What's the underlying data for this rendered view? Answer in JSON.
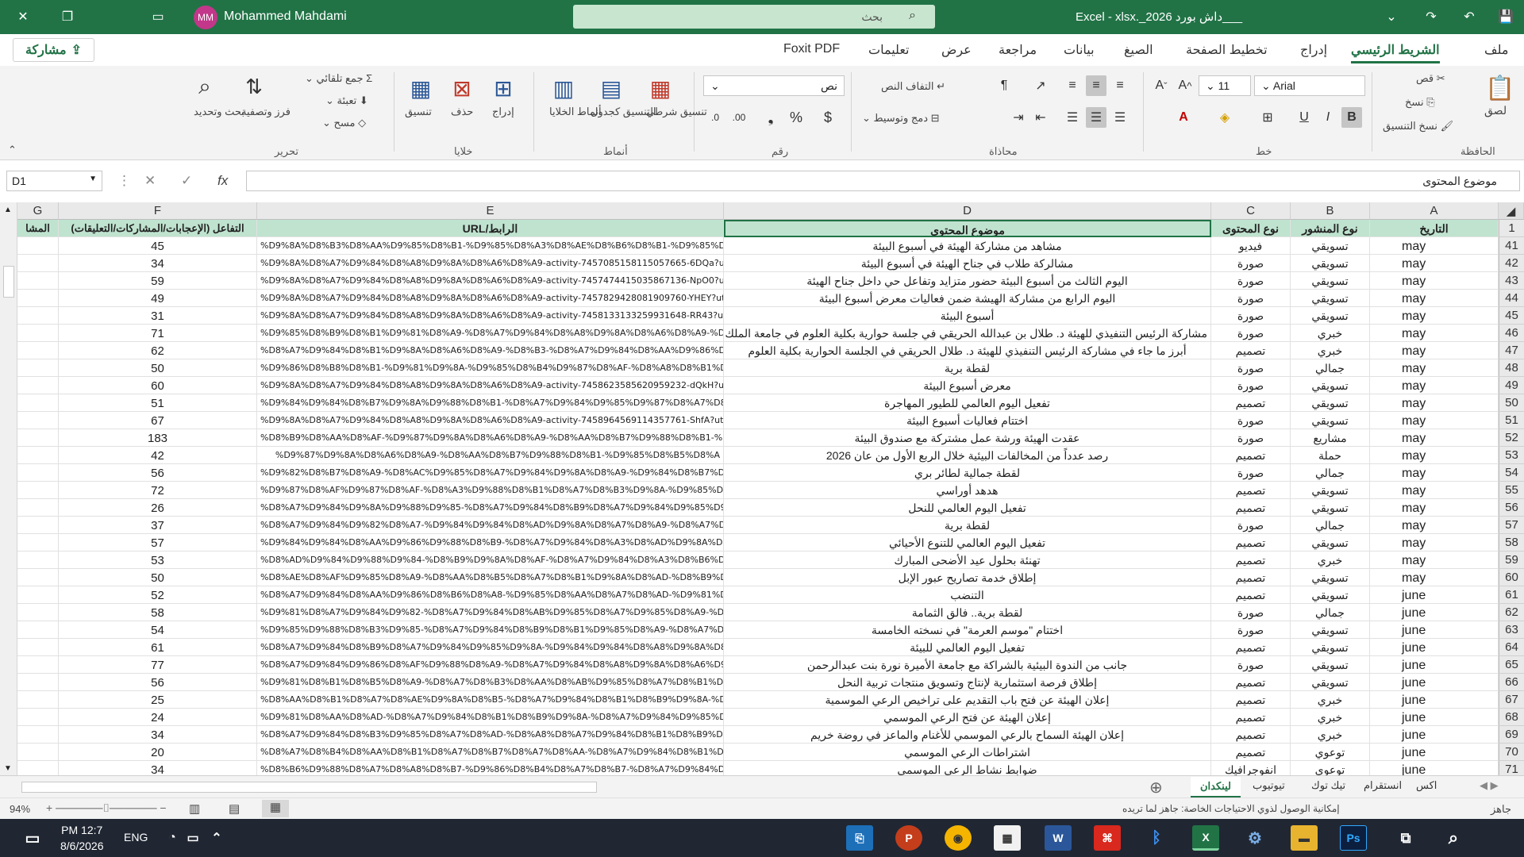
{
  "titlebar": {
    "user_initials": "MM",
    "user_name": "Mohammed Mahdami",
    "search_placeholder": "بحث",
    "doc_title": "Excel  -  xlsx._2026 داش بورد___"
  },
  "share_label": "مشاركة",
  "tabs": [
    "ملف",
    "الشريط الرئيسي",
    "إدراج",
    "تخطيط الصفحة",
    "الصيغ",
    "بيانات",
    "مراجعة",
    "عرض",
    "تعليمات",
    "Foxit PDF"
  ],
  "ribbon": {
    "clipboard": {
      "paste": "لصق",
      "cut": "قص",
      "copy": "نسخ",
      "format_painter": "نسخ التنسيق",
      "group": "الحافظة"
    },
    "font": {
      "name": "Arial",
      "size": "11",
      "group": "خط"
    },
    "alignment": {
      "wrap": "التفاف النص",
      "merge": "دمج وتوسيط",
      "group": "محاذاة"
    },
    "number": {
      "format": "نص",
      "group": "رقم"
    },
    "styles": {
      "conditional": "تنسيق شرطي",
      "table": "التنسيق كجدول",
      "cell_styles": "أنماط الخلايا",
      "group": "أنماط"
    },
    "cells": {
      "insert": "إدراج",
      "delete": "حذف",
      "format": "تنسيق",
      "group": "خلايا"
    },
    "editing": {
      "autosum": "جمع تلقائي",
      "fill": "تعبئة",
      "clear": "مسح",
      "sort": "فرز وتصفية",
      "find": "بحث وتحديد",
      "group": "تحرير"
    }
  },
  "formula_bar": {
    "name_box": "D1",
    "content": "موضوع المحتوى"
  },
  "columns": {
    "A": "A",
    "B": "B",
    "C": "C",
    "D": "D",
    "E": "E",
    "F": "F",
    "G": "G"
  },
  "header_row": {
    "num": "1",
    "date": "التاريخ",
    "type": "نوع المنشور",
    "content_type": "نوع المحتوى",
    "topic": "موضوع المحتوى",
    "url": "الرابط/URL",
    "engagement": "التفاعل (الإعجابات/المشاركات/التعليقات)",
    "g": "المشا"
  },
  "rows": [
    {
      "n": "41",
      "date": "may",
      "type": "تسويقي",
      "ctype": "فيديو",
      "topic": "مشاهد من مشاركة الهيئة في أسبوع البيئة",
      "url": "%D9%8A%D8%B3%D8%AA%D9%85%D8%B1-%D9%85%D8%A3%D8%AE%D8%B6%D8%B1-%D9%85%D8%B",
      "eng": "45"
    },
    {
      "n": "42",
      "date": "may",
      "type": "تسويقي",
      "ctype": "صورة",
      "topic": "مشالركة طلاب في جناح الهيئة  في أسبوع البيئة",
      "url": "%D9%8A%D8%A7%D9%84%D8%A8%D9%8A%D8%A6%D8%A9-activity-7457085158115057665-6DQa?utm_source",
      "eng": "34"
    },
    {
      "n": "43",
      "date": "may",
      "type": "تسويقي",
      "ctype": "صورة",
      "topic": "اليوم الثالث من أسبوع البيئة حضور متزايد وتفاعل حي داخل جناح الهيئة",
      "url": "%D9%8A%D8%A7%D9%84%D8%A8%D9%8A%D8%A6%D8%A9-activity-7457474415035867136-NpO0?utm_source",
      "eng": "59"
    },
    {
      "n": "44",
      "date": "may",
      "type": "تسويقي",
      "ctype": "صورة",
      "topic": "اليوم الرابع من مشاركة الهيشة ضمن فعاليات معرض أسبوع البيئة",
      "url": "%D9%8A%D8%A7%D9%84%D8%A8%D9%8A%D8%A6%D8%A9-activity-7457829428081909760-YHEY?utm_source",
      "eng": "49"
    },
    {
      "n": "45",
      "date": "may",
      "type": "تسويقي",
      "ctype": "صورة",
      "topic": "أسبوع البيئة",
      "url": "%D9%8A%D8%A7%D9%84%D8%A8%D9%8A%D8%A6%D8%A9-activity-7458133133259931648-RR43?utm_source",
      "eng": "31"
    },
    {
      "n": "46",
      "date": "may",
      "type": "خبري",
      "ctype": "صورة",
      "topic": "مشاركة الرئيس التنفيذي للهيئة د. طلال بن عبدالله الحريقي في جلسة حوارية بكلية العلوم في جامعة الملك سعود",
      "url": "%D9%85%D8%B9%D8%B1%D9%81%D8%A9-%D8%A7%D9%84%D8%A8%D9%8A%D8%A6%D8%A9-%D8",
      "eng": "71"
    },
    {
      "n": "47",
      "date": "may",
      "type": "خبري",
      "ctype": "تصميم",
      "topic": "أبرز ما جاء في مشاركة الرئيس التنفيذي للهيئة د. طلال الحريقي في الجلسة الحوارية بكلية العلوم",
      "url": "%D8%A7%D9%84%D8%B1%D9%8A%D8%A6%D8%A9-%D8%B3-%D8%A7%D9%84%D8%AA%D9%86%D9%81%D9",
      "eng": "62"
    },
    {
      "n": "48",
      "date": "may",
      "type": "جمالي",
      "ctype": "صورة",
      "topic": "لقطة برية",
      "url": "%D9%86%D8%B8%D8%B1-%D9%81%D9%8A-%D9%85%D8%B4%D9%87%D8%AF-%D8%A8%D8%B1%D9",
      "eng": "50"
    },
    {
      "n": "49",
      "date": "may",
      "type": "تسويقي",
      "ctype": "صورة",
      "topic": "معرض أسبوع البيئة",
      "url": "%D9%8A%D8%A7%D9%84%D8%A8%D9%8A%D8%A6%D8%A9-activity-7458623585620959232-dQkH?utm_source",
      "eng": "60"
    },
    {
      "n": "50",
      "date": "may",
      "type": "تسويقي",
      "ctype": "تصميم",
      "topic": "تفعيل اليوم العالمي للطيور المهاجرة",
      "url": "%D9%84%D9%84%D8%B7%D9%8A%D9%88%D8%B1-%D8%A7%D9%84%D9%85%D9%87%D8%A7%D8%A",
      "eng": "51"
    },
    {
      "n": "51",
      "date": "may",
      "type": "تسويقي",
      "ctype": "صورة",
      "topic": "اختتام فعاليات أسبوع البيئة",
      "url": "%D9%8A%D8%A7%D9%84%D8%A8%D9%8A%D8%A6%D8%A9-activity-7458964569114357761-ShfA?utm_source",
      "eng": "67"
    },
    {
      "n": "52",
      "date": "may",
      "type": "مشاريع",
      "ctype": "صورة",
      "topic": "عقدت الهيئة ورشة عمل مشتركة مع صندوق البيئة",
      "url": "%D8%B9%D8%AA%D8%AF-%D9%87%D9%8A%D8%A6%D8%A9-%D8%AA%D8%B7%D9%88%D8%B1-%D8%A",
      "eng": "183"
    },
    {
      "n": "53",
      "date": "may",
      "type": "حملة",
      "ctype": "تصميم",
      "topic": "رصد عدداً من المخالفات البيئية خلال الربع الأول من عان 2026",
      "url": "%D9%87%D9%8A%D8%A6%D8%A9-%D8%AA%D8%B7%D9%88%D8%B1-%D9%85%D8%B5%D8%A",
      "eng": "42"
    },
    {
      "n": "54",
      "date": "may",
      "type": "جمالي",
      "ctype": "صورة",
      "topic": "لقطة جمالية لطائر بري",
      "url": "%D9%82%D8%B7%D8%A9-%D8%AC%D9%85%D8%A7%D9%84%D9%8A%D8%A9-%D9%84%D8%B7%D8%A7%D8%A6%D8%B1",
      "eng": "56"
    },
    {
      "n": "55",
      "date": "may",
      "type": "تسويقي",
      "ctype": "تصميم",
      "topic": "هدهد أوراسي",
      "url": "%D9%87%D8%AF%D9%87%D8%AF-%D8%A3%D9%88%D8%B1%D8%A7%D8%B3%D9%8A-%D9%85%D8%A7%D9%87",
      "eng": "72"
    },
    {
      "n": "56",
      "date": "may",
      "type": "تسويقي",
      "ctype": "تصميم",
      "topic": "تفعيل اليوم العالمي للنحل",
      "url": "%D8%A7%D9%84%D9%8A%D9%88%D9%85-%D8%A7%D9%84%D8%B9%D8%A7%D9%84%D9%85%D9%8A-activity-74628667844",
      "eng": "26"
    },
    {
      "n": "57",
      "date": "may",
      "type": "جمالي",
      "ctype": "صورة",
      "topic": "لقطة برية",
      "url": "%D8%A7%D9%84%D9%82%D8%A7-%D9%84%D9%84%D8%AD%D9%8A%D8%A7%D8%A9-%D8%A7%D9%84%D8",
      "eng": "37"
    },
    {
      "n": "58",
      "date": "may",
      "type": "تسويقي",
      "ctype": "تصميم",
      "topic": "تفعيل اليوم العالمي للتنوع الأحيائي",
      "url": "%D9%84%D9%84%D8%AA%D9%86%D9%88%D8%B9-%D8%A7%D9%84%D8%A3%D8%AD%D9%8A%D8%A7%D8",
      "eng": "57"
    },
    {
      "n": "59",
      "date": "may",
      "type": "خبري",
      "ctype": "تصميم",
      "topic": "تهنئة بحلول عيد الأضحى المبارك",
      "url": "%D8%AD%D9%84%D9%88%D9%84-%D8%B9%D9%8A%D8%AF-%D8%A7%D9%84%D8%A3%D8%B6%D8%AD%D9%89-activity-74650777835269",
      "eng": "53"
    },
    {
      "n": "60",
      "date": "may",
      "type": "تسويقي",
      "ctype": "تصميم",
      "topic": "إطلاق خدمة تصاريح عبور الإبل",
      "url": "%D8%AE%D8%AF%D9%85%D8%A9-%D8%AA%D8%B5%D8%A7%D8%B1%D9%8A%D8%AD-%D8%B9%D8%A8%D9%88%D8%B1",
      "eng": "50"
    },
    {
      "n": "61",
      "date": "june",
      "type": "تسويقي",
      "ctype": "تصميم",
      "topic": "التنضب",
      "url": "%D8%A7%D9%84%D8%AA%D9%86%D8%B6%D8%A8-%D9%85%D8%AA%D8%A7%D8%AD-%D9%81%D9%8A",
      "eng": "52"
    },
    {
      "n": "62",
      "date": "june",
      "type": "جمالي",
      "ctype": "صورة",
      "topic": "لقطة برية.. فالق الثمامة",
      "url": "%D9%81%D8%A7%D9%84%D9%82-%D8%A7%D9%84%D8%AB%D9%85%D8%A7%D9%85%D8%A9-%D8%A8%D8%B1%D9%8A%D8%A9",
      "eng": "58"
    },
    {
      "n": "63",
      "date": "june",
      "type": "تسويقي",
      "ctype": "صورة",
      "topic": "اختتام \"موسم العرمة\" في نسخته الخامسة",
      "url": "%D9%85%D9%88%D8%B3%D9%85-%D8%A7%D9%84%D8%B9%D8%B1%D9%85%D8%A9-%D8%A7%D9%84%D8%AE%D8%A7%D9",
      "eng": "54"
    },
    {
      "n": "64",
      "date": "june",
      "type": "تسويقي",
      "ctype": "تصميم",
      "topic": "تفعيل اليوم العالمي للبيئة",
      "url": "%D8%A7%D9%84%D8%B9%D8%A7%D9%84%D9%85%D9%8A-%D9%84%D9%84%D8%A8%D9%8A%D8%A6%D8%A9-activity-7468658",
      "eng": "61"
    },
    {
      "n": "65",
      "date": "june",
      "type": "تسويقي",
      "ctype": "صورة",
      "topic": "جانب من الندوة البيئية بالشراكة مع جامعة الأميرة نورة بنت عبدالرحمن",
      "url": "%D8%A7%D9%84%D9%86%D8%AF%D9%88%D8%A9-%D8%A7%D9%84%D8%A8%D9%8A%D8%A6%D9%8A%D8%A9-%D8%A8%D8",
      "eng": "77"
    },
    {
      "n": "66",
      "date": "june",
      "type": "تسويقي",
      "ctype": "تصميم",
      "topic": "إطلاق فرصة استثمارية لإنتاج وتسويق منتجات تربية النحل",
      "url": "%D9%81%D8%B1%D8%B5%D8%A9-%D8%A7%D8%B3%D8%AA%D8%AB%D9%85%D8%A7%D8%B1%D9%8A%D8%A9-%D9",
      "eng": "56"
    },
    {
      "n": "67",
      "date": "june",
      "type": "خبري",
      "ctype": "تصميم",
      "topic": "إعلان الهيئة عن فتح باب التقديم على تراخيص الرعي الموسمية",
      "url": "%D8%AA%D8%B1%D8%A7%D8%AE%D9%8A%D8%B5-%D8%A7%D9%84%D8%B1%D8%B9%D9%8A-%D8%A7%D9%84%D9%85%D9%88%D8%B3%D9%85%D9",
      "eng": "25"
    },
    {
      "n": "68",
      "date": "june",
      "type": "خبري",
      "ctype": "تصميم",
      "topic": "إعلان الهيئة عن فتح الرعي الموسمي",
      "url": "%D9%81%D8%AA%D8%AD-%D8%A7%D9%84%D8%B1%D8%B9%D9%8A-%D8%A7%D9%84%D9%85%D9%88%D8%B3%D9%85%D9%8A",
      "eng": "24"
    },
    {
      "n": "69",
      "date": "june",
      "type": "خبري",
      "ctype": "تصميم",
      "topic": "إعلان الهيئة السماح بالرعي الموسمي للأغنام والماعز في روضة خريم",
      "url": "%D8%A7%D9%84%D8%B3%D9%85%D8%A7%D8%AD-%D8%A8%D8%A7%D9%84%D8%B1%D8%B9%D9%8A-%D8%A7%D9%84%D9%85",
      "eng": "34"
    },
    {
      "n": "70",
      "date": "june",
      "type": "توعوي",
      "ctype": "تصميم",
      "topic": "اشتراطات الرعي الموسمي",
      "url": "%D8%A7%D8%B4%D8%AA%D8%B1%D8%A7%D8%B7%D8%A7%D8%AA-%D8%A7%D9%84%D8%B1%D8%B9%D9%8A-%D8",
      "eng": "20"
    },
    {
      "n": "71",
      "date": "june",
      "type": "توعوي",
      "ctype": "انفوجرافيك",
      "topic": "ضوابط نشاط الرعي الموسمي",
      "url": "%D8%B6%D9%88%D8%A7%D8%A8%D8%B7-%D9%86%D8%B4%D8%A7%D8%B7-%D8%A7%D9%84%D8%B1%D8%B9%D9%8A",
      "eng": "34"
    }
  ],
  "sheets": [
    "اكس",
    "انستقرام",
    "تيك توك",
    "تيوتيوب",
    "لينكدان"
  ],
  "status": {
    "ready": "جاهز",
    "accessibility": "إمكانية الوصول لذوي الاحتياجات الخاصة: جاهز لما تريده",
    "zoom": "94%"
  },
  "taskbar": {
    "time": "PM 12:7",
    "date": "8/6/2026",
    "lang": "ENG"
  }
}
